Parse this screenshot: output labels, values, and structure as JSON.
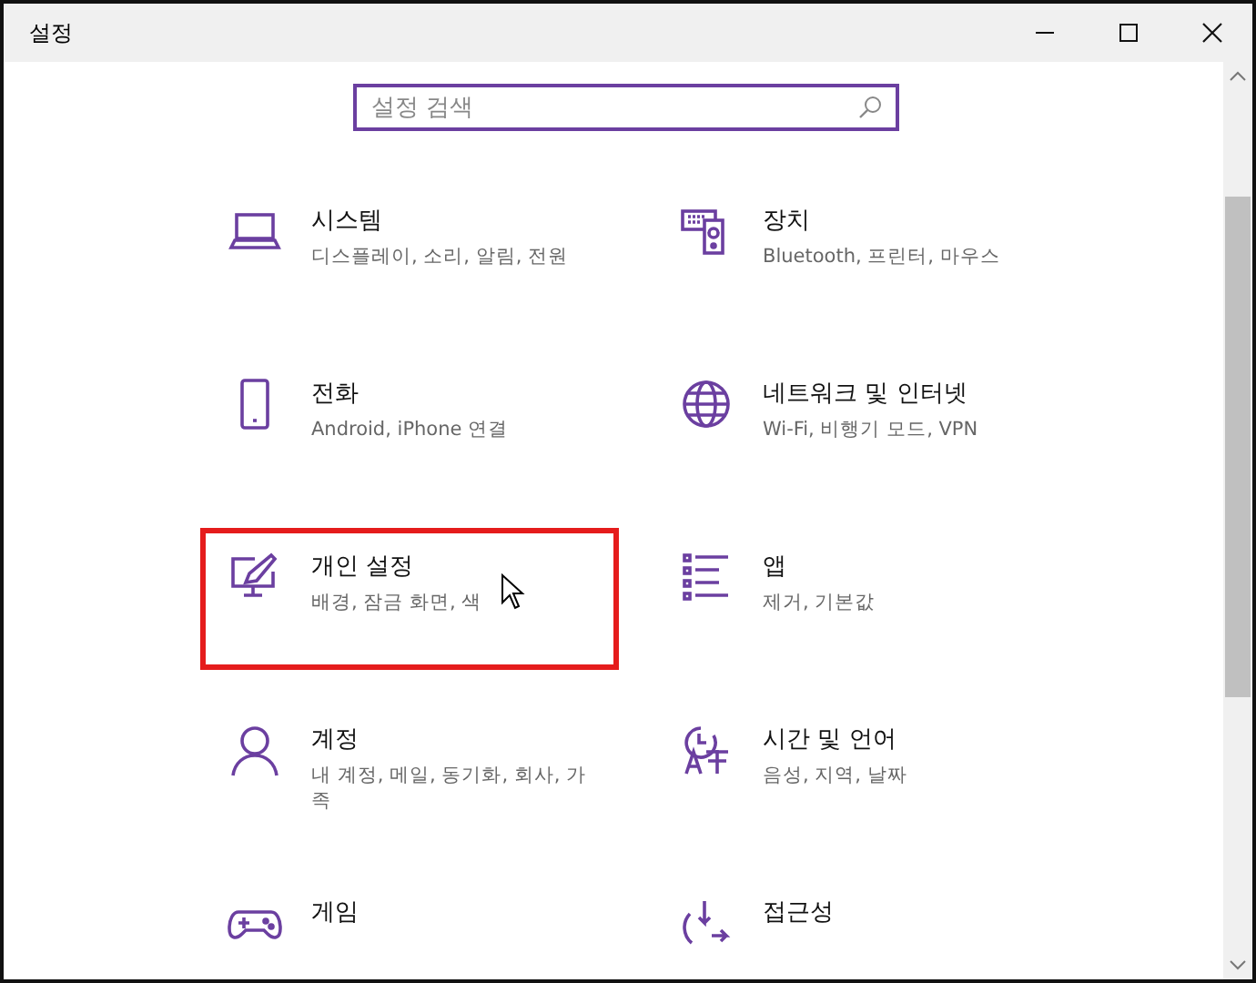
{
  "window": {
    "title": "설정"
  },
  "search": {
    "placeholder": "설정 검색"
  },
  "items": [
    {
      "kind": "laptop",
      "title": "시스템",
      "subtitle": "디스플레이, 소리, 알림, 전원",
      "highlighted": false
    },
    {
      "kind": "keyboard",
      "title": "장치",
      "subtitle": "Bluetooth, 프린터, 마우스",
      "highlighted": false
    },
    {
      "kind": "phone",
      "title": "전화",
      "subtitle": "Android, iPhone 연결",
      "highlighted": false
    },
    {
      "kind": "globe",
      "title": "네트워크 및 인터넷",
      "subtitle": "Wi-Fi, 비행기 모드, VPN",
      "highlighted": false
    },
    {
      "kind": "brush",
      "title": "개인 설정",
      "subtitle": "배경, 잠금 화면, 색",
      "highlighted": true
    },
    {
      "kind": "list",
      "title": "앱",
      "subtitle": "제거, 기본값",
      "highlighted": false
    },
    {
      "kind": "person",
      "title": "계정",
      "subtitle": "내 계정, 메일, 동기화, 회사, 가족",
      "highlighted": false
    },
    {
      "kind": "clock",
      "title": "시간 및 언어",
      "subtitle": "음성, 지역, 날짜",
      "highlighted": false
    },
    {
      "kind": "gamepad",
      "title": "게임",
      "highlighted": false
    },
    {
      "kind": "access",
      "title": "접근성",
      "highlighted": false
    }
  ]
}
